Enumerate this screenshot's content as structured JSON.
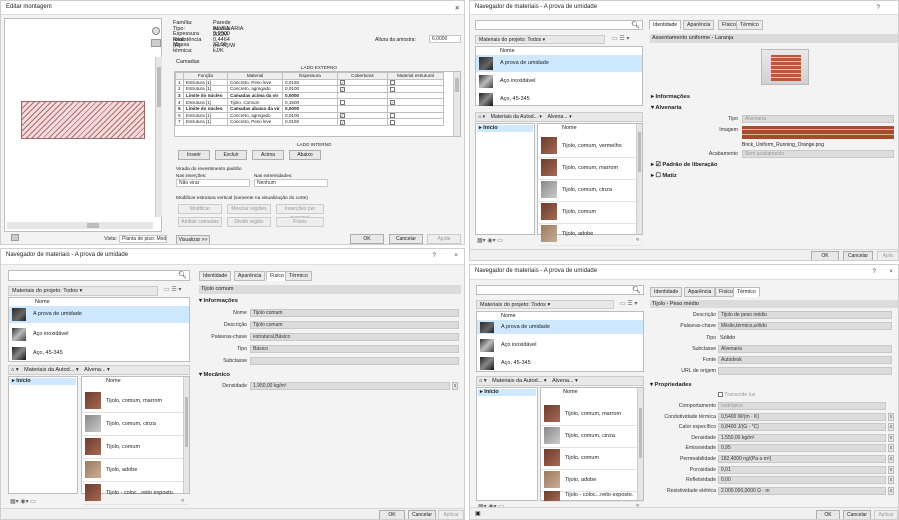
{
  "q1": {
    "title": "Editar montagem",
    "props": [
      {
        "k": "Família:",
        "v": "Parede básica"
      },
      {
        "k": "Tipo:",
        "v": "ALVENARIA 20CM"
      },
      {
        "k": "Espessura total:",
        "v": "0,2000"
      },
      {
        "k": "Resistência (R):",
        "v": "0,4464 (m²·K)/W"
      },
      {
        "k": "Massa térmica:",
        "v": "22,99 kJ/K"
      }
    ],
    "sample_height_label": "Altura da amostra:",
    "sample_height_value": "6,0000",
    "layers_label": "Camadas",
    "exterior_label": "LADO EXTERNO",
    "interior_label": "LADO INTERNO",
    "columns": [
      "",
      "Função",
      "Material",
      "Espessura",
      "Coberturas",
      "Material estrutural"
    ],
    "rows": [
      {
        "n": "1",
        "f": "Estrutura [1]",
        "m": "Concreto, Peso leve",
        "e": "0,0150",
        "c": true,
        "s": false,
        "style": ""
      },
      {
        "n": "2",
        "f": "Estrutura [1]",
        "m": "Concreto, agregado",
        "e": "0,0100",
        "c": true,
        "s": false,
        "style": ""
      },
      {
        "n": "3",
        "f": "Limite do núcleo",
        "m": "Camadas acima da vir",
        "e": "0,0000",
        "c": null,
        "s": null,
        "style": "bold"
      },
      {
        "n": "4",
        "f": "Estrutura [1]",
        "m": "Tijolo, Comum",
        "e": "0,1500",
        "c": false,
        "s": true,
        "style": ""
      },
      {
        "n": "5",
        "f": "Limite do núcleo",
        "m": "Camadas abaixo da vir",
        "e": "0,0000",
        "c": null,
        "s": null,
        "style": "bold"
      },
      {
        "n": "6",
        "f": "Estrutura [1]",
        "m": "Concreto, agregado",
        "e": "0,0100",
        "c": true,
        "s": false,
        "style": ""
      },
      {
        "n": "7",
        "f": "Estrutura [1]",
        "m": "Concreto, Peso leve",
        "e": "0,0150",
        "c": true,
        "s": false,
        "style": ""
      }
    ],
    "layer_buttons": [
      "Inserir",
      "Excluir",
      "Acima",
      "Abaixo"
    ],
    "wrap_label": "Virada do revestimento padrão",
    "wrap_inserts_label": "Nas inserções:",
    "wrap_inserts_value": "Não virar",
    "wrap_ends_label": "Nas extremidades:",
    "wrap_ends_value": "Nenhum",
    "vertical_label": "Modificar estrutura vertical (somente na visualização do corte)",
    "vertical_buttons_row1": [
      "Modificar",
      "Mesclar regiões",
      "Inserções per personal"
    ],
    "vertical_buttons_row2": [
      "Atribuir camadas",
      "Dividir região",
      "Frisos"
    ],
    "view_label": "Vista:",
    "view_value": "Planta de piso: Modi",
    "preview_button": "Visualizar >>",
    "ok": "OK",
    "cancel": "Cancelar",
    "help": "Ajuda"
  },
  "q2": {
    "title": "Navegador de materiais - A prova de umidade",
    "help_q": "?",
    "close_x": "×",
    "filter": "Materiais do projeto: Todos",
    "col_name": "Nome",
    "project_materials": [
      "A prova de umidade",
      "Aço inoxidável",
      "Aço, 45-345"
    ],
    "lib_breadcrumb": [
      "Materiais da Autod...",
      "Alvena..."
    ],
    "lib_home": "Início",
    "lib_col": "Nome",
    "lib_items": [
      "Tijolo, comum, vermelho",
      "Tijolo, comum, marrom",
      "Tijolo, comum, cinza",
      "Tijolo, comum",
      "Tijolo, adobe"
    ],
    "tabs": [
      "Identidade",
      "Aparência",
      "Físico",
      "Térmico"
    ],
    "asset_name": "Assentamento uniforme - Laranja",
    "sections": {
      "info": "Informações",
      "masonry": "Alvenaria",
      "relief": "Padrão de liberação",
      "tint": "Matiz"
    },
    "tipo_label": "Tipo",
    "tipo_value": "Alvenaria",
    "imagem_label": "Imagem",
    "image_file": "Brick_Uniform_Running_Orange.png",
    "acab_label": "Acabamento",
    "acab_value": "Sem acabamento",
    "ok": "OK",
    "cancel": "Cancelar",
    "apply": "Aplic"
  },
  "q3": {
    "title": "Navegador de materiais - A prova de umidade",
    "help_q": "?",
    "close_x": "×",
    "filter": "Materiais do projeto: Todos",
    "col_name": "Nome",
    "project_materials": [
      "A prova de umidade",
      "Aço inoxidável",
      "Aço, 45-345"
    ],
    "lib_breadcrumb": [
      "Materiais da Autod...",
      "Alvena..."
    ],
    "lib_home": "Início",
    "lib_col": "Nome",
    "lib_items": [
      "Tijolo, comum, marrom",
      "Tijolo, comum, cinza",
      "Tijolo, comum",
      "Tijolo, adobe",
      "Tijolo - coloc...reito exposto."
    ],
    "tabs": [
      "Identidade",
      "Aparência",
      "Físico",
      "Térmico"
    ],
    "asset_name": "Tijolo comum",
    "sections": {
      "info": "Informações",
      "mech": "Mecânico"
    },
    "fields": [
      {
        "k": "Nome",
        "v": "Tijolo comum"
      },
      {
        "k": "Descrição",
        "v": "Tijolo comum"
      },
      {
        "k": "Palavras-chave",
        "v": "estrutural,Básico"
      },
      {
        "k": "Tipo",
        "v": "Básico"
      },
      {
        "k": "Subclasse",
        "v": ""
      }
    ],
    "density_label": "Densidade",
    "density_value": "1.950,00 kg/m³",
    "ok": "OK",
    "cancel": "Cancelar",
    "apply": "Aplicar"
  },
  "q4": {
    "title": "Navegador de materiais - A prova de umidade",
    "help_q": "?",
    "close_x": "×",
    "filter": "Materiais do projeto: Todos",
    "col_name": "Nome",
    "project_materials": [
      "A prova de umidade",
      "Aço inoxidável",
      "Aço, 45-345"
    ],
    "lib_breadcrumb": [
      "Materiais da Autod...",
      "Alvena..."
    ],
    "lib_home": "Início",
    "lib_col": "Nome",
    "lib_items": [
      "Tijolo, comum, marrom",
      "Tijolo, comum, cinza",
      "Tijolo, comum",
      "Tijolo, adobe",
      "Tijolo - coloc...reito exposto."
    ],
    "tabs": [
      "Identidade",
      "Aparência",
      "Físico",
      "Térmico"
    ],
    "asset_name": "Tijolo - Peso médio",
    "fields": [
      {
        "k": "Descrição",
        "v": "Tijolo de peso médio"
      },
      {
        "k": "Palavras-chave",
        "v": "Médio,térmico,sólido"
      },
      {
        "k": "Tipo",
        "v": "Sólido"
      },
      {
        "k": "Subclasse",
        "v": "Alvenaria"
      },
      {
        "k": "Fonte",
        "v": "Autodesk"
      },
      {
        "k": "URL de origem",
        "v": ""
      }
    ],
    "props_section": "Propriedades",
    "transmit_label": "Transmite luz",
    "props": [
      {
        "k": "Comportamento",
        "v": "Isotrópico"
      },
      {
        "k": "Condutividade térmica",
        "v": "0,5400 W/(m · K)"
      },
      {
        "k": "Calor específico",
        "v": "0,8400 J/(G · °C)"
      },
      {
        "k": "Densidade",
        "v": "1.550,00 kg/m³"
      },
      {
        "k": "Emissividade",
        "v": "0,95"
      },
      {
        "k": "Permeabilidade",
        "v": "182,4000 ng/(Pa·s·m²)"
      },
      {
        "k": "Porosidade",
        "v": "0,01"
      },
      {
        "k": "Refletividade",
        "v": "0,00"
      },
      {
        "k": "Resistividade elétrica",
        "v": "2.000.000,0000 Ω · m"
      }
    ],
    "ok": "OK",
    "cancel": "Cancelar",
    "apply": "Aplicar"
  }
}
